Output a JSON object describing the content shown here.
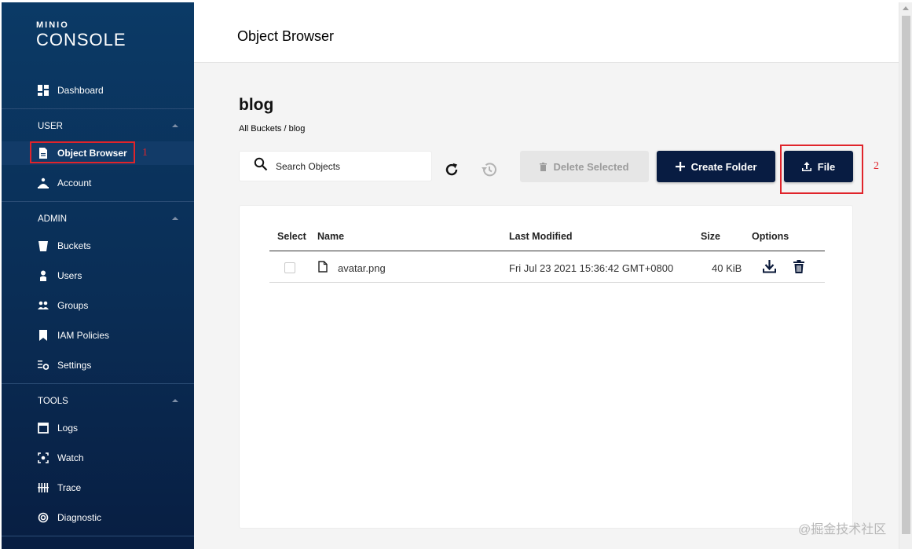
{
  "brand": {
    "small": "MINIO",
    "big": "CONSOLE"
  },
  "sidebar": {
    "top_items": [
      {
        "label": "Dashboard"
      }
    ],
    "user": {
      "heading": "USER",
      "items": [
        {
          "label": "Object Browser"
        },
        {
          "label": "Account"
        }
      ]
    },
    "admin": {
      "heading": "ADMIN",
      "items": [
        {
          "label": "Buckets"
        },
        {
          "label": "Users"
        },
        {
          "label": "Groups"
        },
        {
          "label": "IAM Policies"
        },
        {
          "label": "Settings"
        }
      ]
    },
    "tools": {
      "heading": "TOOLS",
      "items": [
        {
          "label": "Logs"
        },
        {
          "label": "Watch"
        },
        {
          "label": "Trace"
        },
        {
          "label": "Diagnostic"
        }
      ]
    }
  },
  "annotations": {
    "marker1": "1",
    "marker2": "2"
  },
  "header": {
    "title": "Object Browser"
  },
  "bucket": {
    "name": "blog",
    "breadcrumb": "All Buckets / blog"
  },
  "toolbar": {
    "search_placeholder": "Search Objects",
    "delete_label": "Delete Selected",
    "create_folder_label": "Create Folder",
    "upload_label": "File"
  },
  "table": {
    "headers": {
      "select": "Select",
      "name": "Name",
      "modified": "Last Modified",
      "size": "Size",
      "options": "Options"
    },
    "rows": [
      {
        "name": "avatar.png",
        "modified": "Fri Jul 23 2021 15:36:42 GMT+0800",
        "size": "40 KiB"
      }
    ]
  },
  "watermark": "@掘金技术社区",
  "colors": {
    "sidebar": "#0a2d55",
    "accent_dark": "#081c42",
    "annotation_red": "#e0242b"
  }
}
